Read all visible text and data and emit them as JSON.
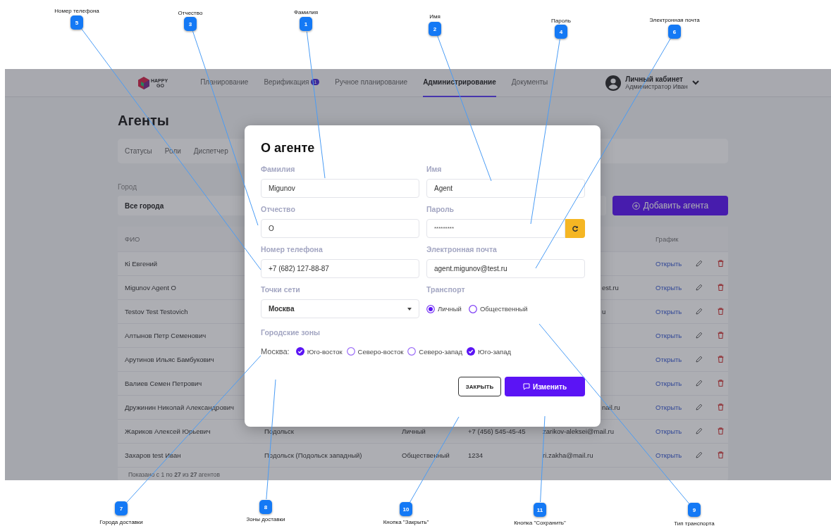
{
  "annotations": [
    {
      "number": "5",
      "label": "Номер телефона"
    },
    {
      "number": "3",
      "label": "Отчество"
    },
    {
      "number": "1",
      "label": "Фамилия"
    },
    {
      "number": "2",
      "label": "Имя"
    },
    {
      "number": "4",
      "label": "Пароль"
    },
    {
      "number": "6",
      "label": "Электронная почта"
    },
    {
      "number": "7",
      "label": "Города доставки"
    },
    {
      "number": "8",
      "label": "Зоны доставки"
    },
    {
      "number": "10",
      "label": "Кнопка \"Закрыть\""
    },
    {
      "number": "11",
      "label": "Кнопка \"Сохранить\""
    },
    {
      "number": "9",
      "label": "Тип транспорта"
    }
  ],
  "nav": {
    "logo": {
      "line1": "HAPPY",
      "line2": "GO"
    },
    "items": [
      {
        "label": "Планирование",
        "selected": false
      },
      {
        "label": "Верификация",
        "selected": false,
        "badge": "1"
      },
      {
        "label": "Ручное планирование",
        "selected": false
      },
      {
        "label": "Администрирование",
        "selected": true
      },
      {
        "label": "Документы",
        "selected": false
      }
    ],
    "user": {
      "title": "Личный кабинет",
      "subtitle": "Администратор Иван"
    }
  },
  "page": {
    "title": "Агенты",
    "tabs": [
      "Статусы",
      "Роли",
      "Диспетчер"
    ],
    "filter": {
      "label": "Город",
      "value": "Все города"
    },
    "add_button": "Добавить агента"
  },
  "table": {
    "columns": [
      {
        "label": "ФИО"
      },
      {
        "label": "График"
      }
    ],
    "rows": [
      {
        "name": "Кі Евгений",
        "link": "Открыть"
      },
      {
        "name": "Migunov Agent O",
        "email": "est.ru",
        "email_partial": true,
        "link": "Открыть"
      },
      {
        "name": "Testov Test Testovich",
        "email": "u",
        "email_partial": true,
        "link": "Открыть"
      },
      {
        "name": "Алтынов Петр Семенович",
        "link": "Открыть"
      },
      {
        "name": "Арутинов Ильяс Бамбукович",
        "link": "Открыть"
      },
      {
        "name": "Валиев Семен Петрович",
        "link": "Открыть"
      },
      {
        "name": "Дружинин Николай Александрович",
        "email": "nail.ru",
        "email_partial": true,
        "link": "Открыть"
      },
      {
        "name": "Жариков Алексей Юрьевич",
        "city": "Подольск",
        "transport": "Личный",
        "phone": "+7 (456) 545-45-45",
        "email": "zarikov-aleksei@mail.ru",
        "email_partial": false,
        "link": "Открыть"
      },
      {
        "name": "Захаров test Иван",
        "city": "Подольск (Подольск западный)",
        "transport": "Общественный",
        "phone": "1234",
        "email": "ri.zakha@mail.ru",
        "email_partial": false,
        "link": "Открыть"
      }
    ],
    "footer": "Показано с 1 по **27** из **27** агентов"
  },
  "modal": {
    "title": "О агенте",
    "fields": [
      {
        "kind": "text",
        "label": "Фамилия",
        "value": "Migunov"
      },
      {
        "kind": "text",
        "label": "Имя",
        "value": "Agent"
      },
      {
        "kind": "text",
        "label": "Отчество",
        "value": "O"
      },
      {
        "kind": "password",
        "label": "Пароль",
        "value": "*********"
      },
      {
        "kind": "text",
        "label": "Номер телефона",
        "value": "+7 (682) 127-88-87"
      },
      {
        "kind": "text",
        "label": "Электронная почта",
        "value": "agent.migunov@test.ru"
      },
      {
        "kind": "select",
        "label": "Точки сети",
        "value": "Москва"
      },
      {
        "kind": "radio",
        "label": "Транспорт",
        "options": [
          {
            "label": "Личный",
            "selected": true
          },
          {
            "label": "Общественный",
            "selected": false
          }
        ]
      }
    ],
    "zones": {
      "label": "Городские зоны",
      "city": "Москва:",
      "options": [
        {
          "label": "Юго-восток",
          "checked": true
        },
        {
          "label": "Северо-восток",
          "checked": false
        },
        {
          "label": "Северо-запад",
          "checked": false
        },
        {
          "label": "Юго-запад",
          "checked": true
        }
      ]
    },
    "close_button": "ЗАКРЫТЬ",
    "save_button": "Изменить"
  }
}
